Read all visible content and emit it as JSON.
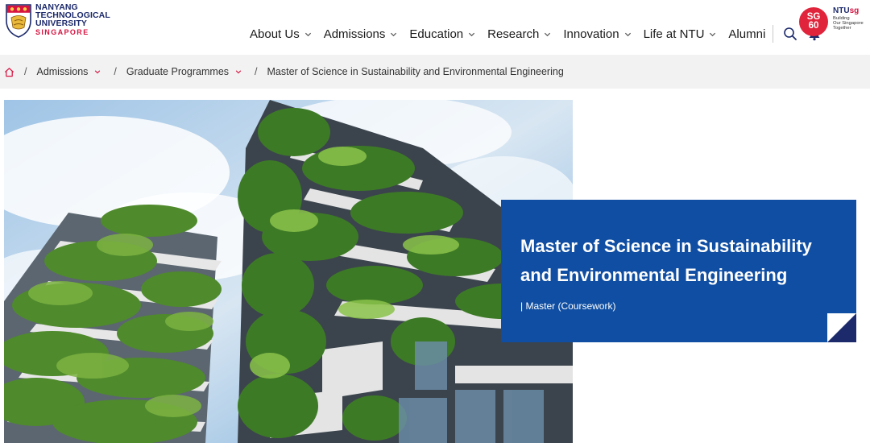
{
  "logo": {
    "line1": "NANYANG",
    "line2": "TECHNOLOGICAL",
    "line3": "UNIVERSITY",
    "line4": "SINGAPORE"
  },
  "nav": {
    "items": [
      {
        "label": "About Us",
        "has_dropdown": true
      },
      {
        "label": "Admissions",
        "has_dropdown": true
      },
      {
        "label": "Education",
        "has_dropdown": true
      },
      {
        "label": "Research",
        "has_dropdown": true
      },
      {
        "label": "Innovation",
        "has_dropdown": true
      },
      {
        "label": "Life at NTU",
        "has_dropdown": true
      },
      {
        "label": "Alumni",
        "has_dropdown": false
      }
    ],
    "icons": [
      "search-icon",
      "bell-icon"
    ]
  },
  "sg60": {
    "badge_top": "SG",
    "badge_bottom": "60",
    "brand_prefix": "NTU",
    "brand_suffix": "sg",
    "tagline_1": "Building",
    "tagline_2": "Our Singapore",
    "tagline_3": "Together"
  },
  "breadcrumb": {
    "items": [
      "Admissions",
      "Graduate Programmes"
    ],
    "current": "Master of Science in Sustainability and Environmental Engineering"
  },
  "hero": {
    "title": "Master of Science in Sustainability and Environmental Engineering",
    "subtitle": "| Master (Coursework)"
  },
  "colors": {
    "primary_blue": "#0f4ea2",
    "brand_navy": "#1c2a6b",
    "brand_red": "#d71440",
    "sg60_red": "#e0243b",
    "breadcrumb_bg": "#f2f2f2"
  }
}
